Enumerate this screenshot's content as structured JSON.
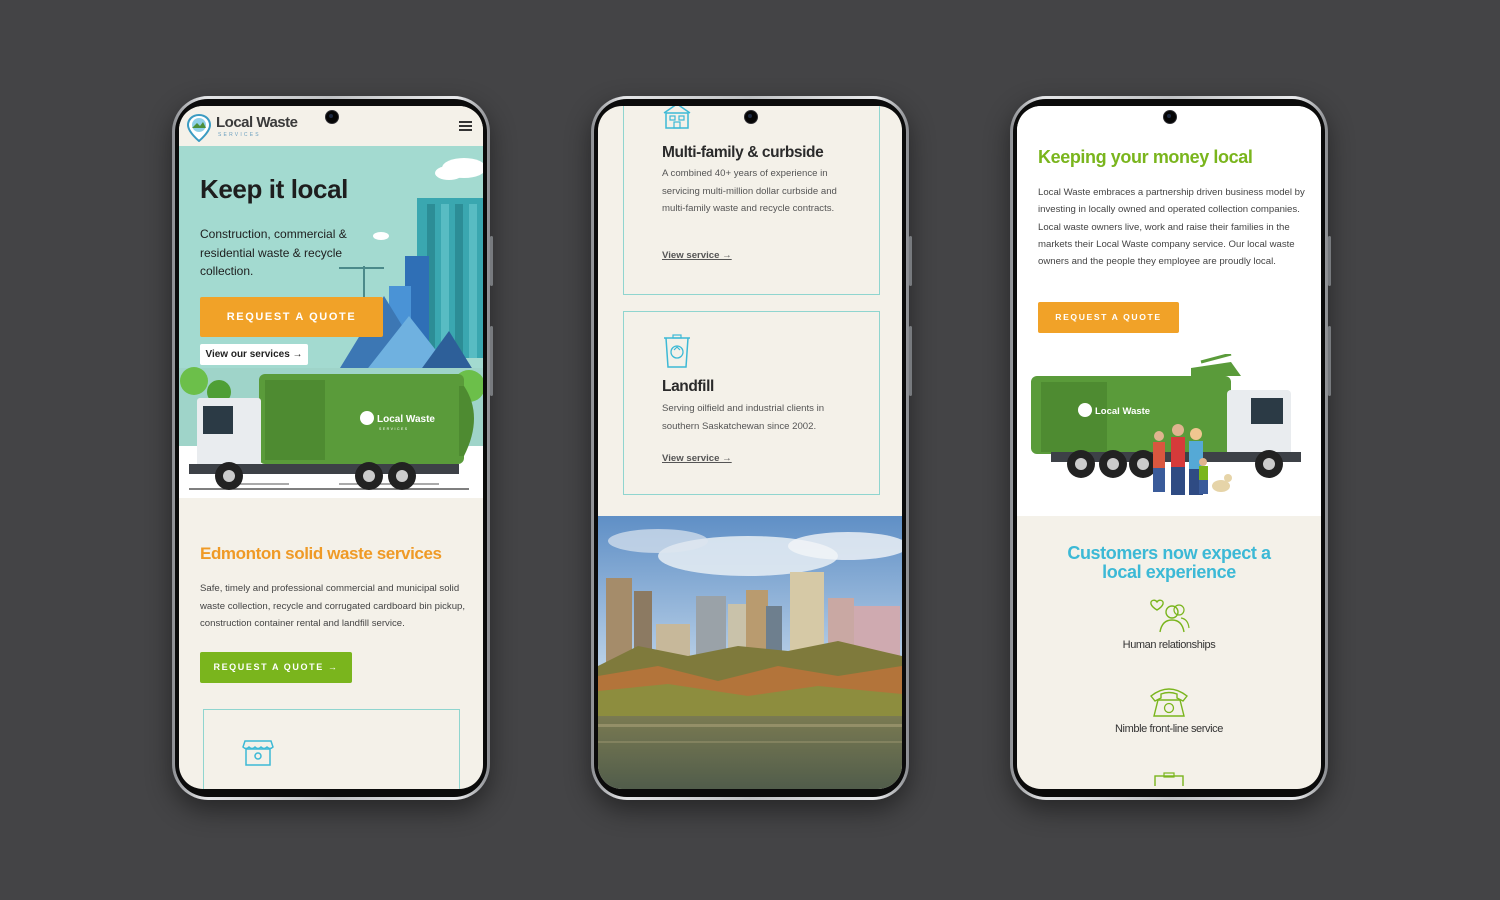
{
  "brand": {
    "name": "Local Waste",
    "tagline": "SERVICES",
    "colors": {
      "orange": "#f1a228",
      "green": "#7ab51d",
      "teal": "#3cb9d6",
      "cream": "#f4f1e9"
    }
  },
  "phone1": {
    "hero": {
      "title": "Keep it local",
      "text": "Construction, commercial & residential waste & recycle collection.",
      "cta": "REQUEST A QUOTE",
      "link": "View our services →"
    },
    "section": {
      "title": "Edmonton solid waste services",
      "text": "Safe, timely and professional commercial and municipal solid waste collection, recycle and corrugated cardboard bin pickup, construction container rental and landfill service.",
      "cta": "REQUEST A QUOTE →"
    }
  },
  "phone2": {
    "services": [
      {
        "title": "Multi-family & curbside",
        "text": "A combined 40+ years of experience in servicing multi-million dollar curbside and multi-family waste and recycle contracts.",
        "link": "View service →",
        "icon": "building-icon"
      },
      {
        "title": "Landfill",
        "text": "Serving oilfield and industrial clients in southern Saskatchewan since 2002.",
        "link": "View service →",
        "icon": "recycle-bin-icon"
      }
    ]
  },
  "phone3": {
    "title": "Keeping your money local",
    "text": "Local Waste embraces a partnership driven business model by investing in locally owned and operated collection companies. Local waste owners live, work and raise their families in the markets their Local Waste company service. Our local waste owners and the people they employee are proudly local.",
    "cta": "REQUEST A QUOTE",
    "heading": "Customers now expect a local experience",
    "features": [
      {
        "label": "Human relationships",
        "icon": "people-heart-icon"
      },
      {
        "label": "Nimble front-line service",
        "icon": "phone-icon"
      }
    ]
  }
}
